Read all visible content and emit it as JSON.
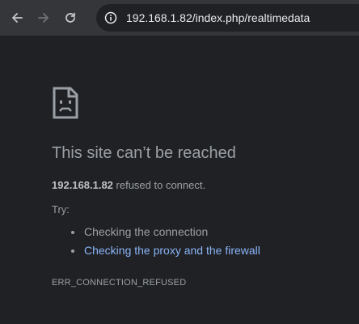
{
  "browser": {
    "url_host": "192.168.1.82",
    "url_path": "/index.php/realtimedata"
  },
  "error_page": {
    "title": "This site can’t be reached",
    "host": "192.168.1.82",
    "message": " refused to connect.",
    "try_label": "Try:",
    "suggestions": [
      "Checking the connection",
      "Checking the proxy and the firewall"
    ],
    "error_code": "ERR_CONNECTION_REFUSED"
  },
  "colors": {
    "background": "#202124",
    "toolbar": "#35363a",
    "text": "#9aa0a6",
    "link": "#8ab4f8"
  },
  "icons": {
    "back": "back-arrow-icon",
    "forward": "forward-arrow-icon",
    "reload": "reload-icon",
    "info": "info-icon",
    "page": "sad-page-icon"
  }
}
